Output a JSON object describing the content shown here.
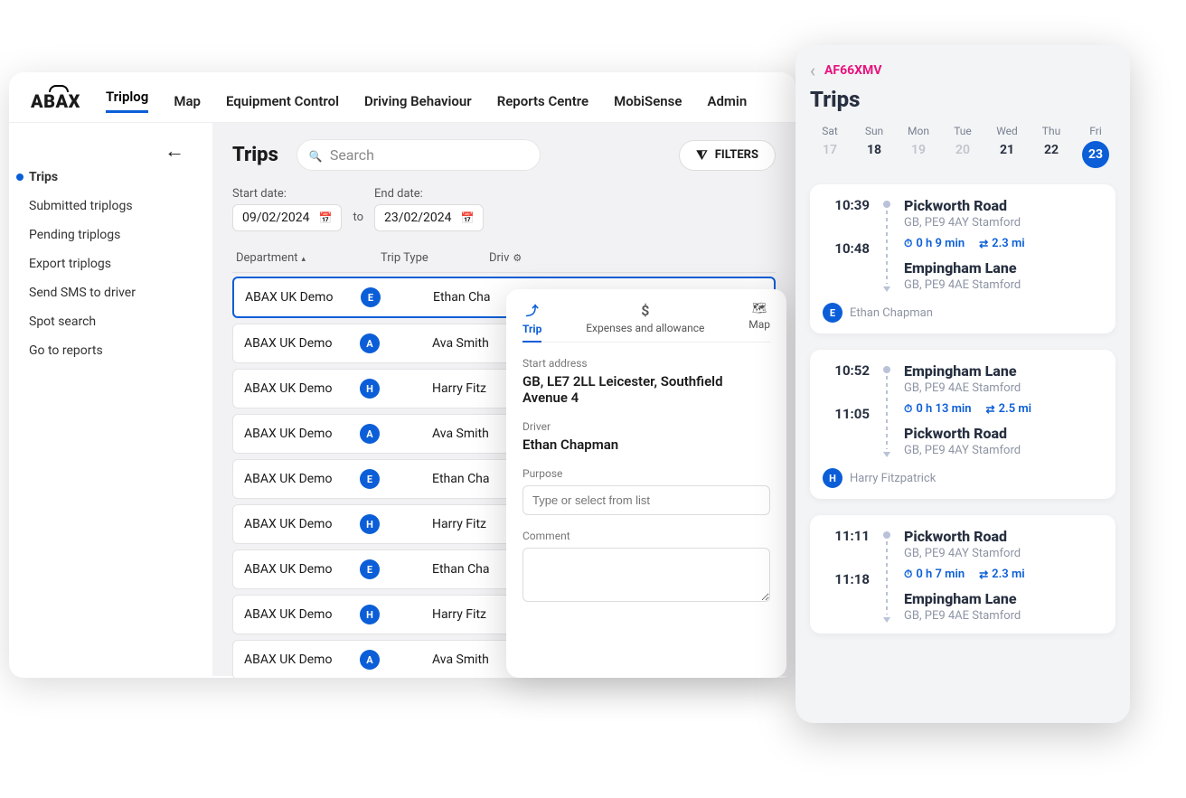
{
  "brand": "ABAX",
  "nav": [
    "Triplog",
    "Map",
    "Equipment Control",
    "Driving Behaviour",
    "Reports Centre",
    "MobiSense",
    "Admin"
  ],
  "nav_active": 0,
  "sidebar": {
    "items": [
      "Trips",
      "Submitted triplogs",
      "Pending triplogs",
      "Export triplogs",
      "Send SMS to driver",
      "Spot search",
      "Go to reports"
    ],
    "active": 0
  },
  "page": {
    "title": "Trips",
    "search_placeholder": "Search",
    "filters_label": "FILTERS",
    "start_label": "Start date:",
    "end_label": "End date:",
    "start_date": "09/02/2024",
    "end_date": "23/02/2024",
    "to_word": "to"
  },
  "table": {
    "headers": {
      "dept": "Department",
      "type": "Trip Type",
      "driver": "Driv"
    },
    "rows": [
      {
        "dept": "ABAX UK Demo",
        "initial": "E",
        "driver": "Ethan Cha"
      },
      {
        "dept": "ABAX UK Demo",
        "initial": "A",
        "driver": "Ava Smith"
      },
      {
        "dept": "ABAX UK Demo",
        "initial": "H",
        "driver": "Harry Fitz"
      },
      {
        "dept": "ABAX UK Demo",
        "initial": "A",
        "driver": "Ava Smith"
      },
      {
        "dept": "ABAX UK Demo",
        "initial": "E",
        "driver": "Ethan Cha"
      },
      {
        "dept": "ABAX UK Demo",
        "initial": "H",
        "driver": "Harry Fitz"
      },
      {
        "dept": "ABAX UK Demo",
        "initial": "E",
        "driver": "Ethan Cha"
      },
      {
        "dept": "ABAX UK Demo",
        "initial": "H",
        "driver": "Harry Fitz"
      },
      {
        "dept": "ABAX UK Demo",
        "initial": "A",
        "driver": "Ava Smith"
      }
    ]
  },
  "detail": {
    "tabs": {
      "trip": "Trip",
      "exp": "Expenses and allowance",
      "map": "Map"
    },
    "start_label": "Start address",
    "start_value": "GB, LE7 2LL Leicester, Southfield Avenue 4",
    "driver_label": "Driver",
    "driver_value": "Ethan Chapman",
    "purpose_label": "Purpose",
    "purpose_placeholder": "Type or select from list",
    "comment_label": "Comment"
  },
  "mobile": {
    "vehicle": "AF66XMV",
    "title": "Trips",
    "days": [
      {
        "dow": "Sat",
        "num": "17",
        "muted": true
      },
      {
        "dow": "Sun",
        "num": "18"
      },
      {
        "dow": "Mon",
        "num": "19",
        "muted": true
      },
      {
        "dow": "Tue",
        "num": "20",
        "muted": true
      },
      {
        "dow": "Wed",
        "num": "21"
      },
      {
        "dow": "Thu",
        "num": "22"
      },
      {
        "dow": "Fri",
        "num": "23",
        "selected": true
      }
    ],
    "trips": [
      {
        "t1": "10:39",
        "p1": "Pickworth Road",
        "a1": "GB, PE9 4AY Stamford",
        "dur": "0 h 9 min",
        "dist": "2.3 mi",
        "t2": "10:48",
        "p2": "Empingham Lane",
        "a2": "GB, PE9 4AE Stamford",
        "drv_i": "E",
        "drv": "Ethan Chapman"
      },
      {
        "t1": "10:52",
        "p1": "Empingham Lane",
        "a1": "GB, PE9 4AE Stamford",
        "dur": "0 h 13 min",
        "dist": "2.5 mi",
        "t2": "11:05",
        "p2": "Pickworth Road",
        "a2": "GB, PE9 4AY Stamford",
        "drv_i": "H",
        "drv": "Harry Fitzpatrick"
      },
      {
        "t1": "11:11",
        "p1": "Pickworth Road",
        "a1": "GB, PE9 4AY Stamford",
        "dur": "0 h 7 min",
        "dist": "2.3 mi",
        "t2": "11:18",
        "p2": "Empingham Lane",
        "a2": "GB, PE9 4AE Stamford"
      }
    ]
  }
}
